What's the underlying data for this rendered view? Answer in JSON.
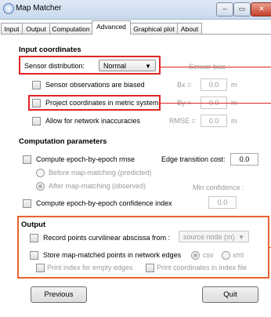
{
  "window": {
    "title": "Map Matcher",
    "btn_min": "–",
    "btn_max": "▭",
    "btn_close": "✕"
  },
  "tabs": [
    "Input",
    "Output",
    "Computation",
    "Advanced",
    "Graphical plot",
    "About"
  ],
  "input_coordinates": {
    "heading": "Input coordinates",
    "sensor_distribution_label": "Sensor distribution:",
    "sensor_distribution_value": "Normal",
    "sensor_bias_label": "Sensor bias :",
    "sensor_biased": "Sensor observations are biased",
    "bx_label": "Bx =",
    "bx_value": "0.0",
    "bx_unit": "m",
    "project_metric": "Project coordinates in metric system",
    "by_label": "By =",
    "by_value": "0.0",
    "by_unit": "m",
    "network_inaccuracies": "Allow for network inaccuracies",
    "rmse_label": "RMSE =",
    "rmse_value": "0.0",
    "rmse_unit": "m"
  },
  "computation": {
    "heading": "Computation parameters",
    "epoch_rmse": "Compute epoch-by-epoch rmse",
    "edge_cost_label": "Edge transition cost:",
    "edge_cost_value": "0.0",
    "before": "Before map-matching (predicted)",
    "after": "After map-matching (observed)",
    "min_conf_label": "Min confidence :",
    "confidence_index": "Compute epoch-by-epoch confidence index",
    "confidence_value": "0.0"
  },
  "output": {
    "heading": "Output",
    "curvilinear": "Record points curvilinear abscissa from :",
    "curvilinear_value": "source node (m)",
    "store_edges": "Store map-matched points in network edges",
    "csv": "csv",
    "xml": "xml",
    "print_index": "Print index for empty edges",
    "print_coords": "Print coordinates in index file"
  },
  "buttons": {
    "previous": "Previous",
    "quit": "Quit"
  },
  "colors": {
    "red": "#e02525",
    "orange": "#e8622f"
  }
}
